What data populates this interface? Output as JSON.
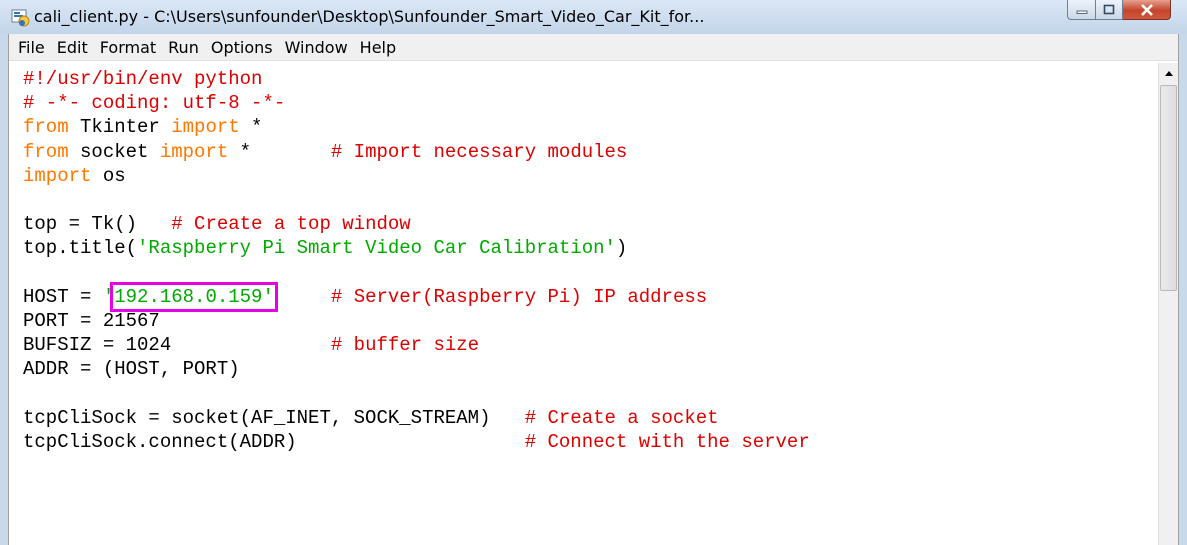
{
  "window": {
    "title": "cali_client.py - C:\\Users\\sunfounder\\Desktop\\Sunfounder_Smart_Video_Car_Kit_for...",
    "icon": "python-idle-icon",
    "controls": [
      "minimize-icon",
      "maximize-icon",
      "close-icon"
    ]
  },
  "menu": {
    "items": [
      "File",
      "Edit",
      "Format",
      "Run",
      "Options",
      "Window",
      "Help"
    ]
  },
  "code": {
    "lines": [
      [
        {
          "t": "#!/usr/bin/env python",
          "c": "cm"
        }
      ],
      [
        {
          "t": "# -*- coding: utf-8 -*-",
          "c": "cm"
        }
      ],
      [
        {
          "t": "from",
          "c": "kw"
        },
        {
          "t": " Tkinter ",
          "c": ""
        },
        {
          "t": "import",
          "c": "kw"
        },
        {
          "t": " *",
          "c": ""
        }
      ],
      [
        {
          "t": "from",
          "c": "kw"
        },
        {
          "t": " socket ",
          "c": ""
        },
        {
          "t": "import",
          "c": "kw"
        },
        {
          "t": " *       ",
          "c": ""
        },
        {
          "t": "# Import necessary modules",
          "c": "cm"
        }
      ],
      [
        {
          "t": "import",
          "c": "kw"
        },
        {
          "t": " os",
          "c": ""
        }
      ],
      [],
      [
        {
          "t": "top = Tk()   ",
          "c": ""
        },
        {
          "t": "# Create a top window",
          "c": "cm"
        }
      ],
      [
        {
          "t": "top.title(",
          "c": ""
        },
        {
          "t": "'Raspberry Pi Smart Video Car Calibration'",
          "c": "st"
        },
        {
          "t": ")",
          "c": ""
        }
      ],
      [],
      [
        {
          "t": "HOST = ",
          "c": ""
        },
        {
          "t": "'",
          "c": "st"
        },
        {
          "t": "192.168.0.159'",
          "c": "st",
          "hl": true
        },
        {
          "t": "     ",
          "c": ""
        },
        {
          "t": "# Server(Raspberry Pi) IP address",
          "c": "cm"
        }
      ],
      [
        {
          "t": "PORT = 21567",
          "c": ""
        }
      ],
      [
        {
          "t": "BUFSIZ = 1024              ",
          "c": ""
        },
        {
          "t": "# buffer size",
          "c": "cm"
        }
      ],
      [
        {
          "t": "ADDR = (HOST, PORT)",
          "c": ""
        }
      ],
      [],
      [
        {
          "t": "tcpCliSock = socket(AF_INET, SOCK_STREAM)   ",
          "c": ""
        },
        {
          "t": "# Create a socket",
          "c": "cm"
        }
      ],
      [
        {
          "t": "tcpCliSock.connect(ADDR)                    ",
          "c": ""
        },
        {
          "t": "# Connect with the server",
          "c": "cm"
        }
      ]
    ],
    "highlight_color": "#e600e6",
    "colors": {
      "keyword": "#ff7700",
      "comment": "#dd0000",
      "string": "#00aa00"
    }
  }
}
